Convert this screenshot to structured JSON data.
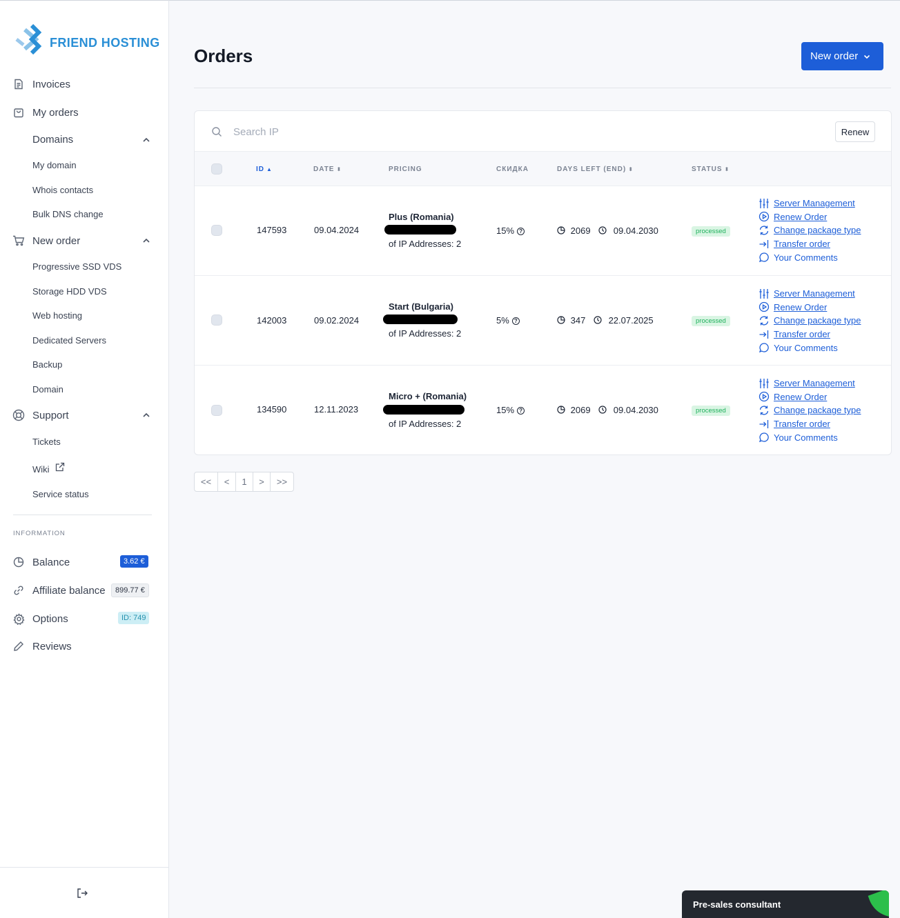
{
  "brand": {
    "name": "FRIEND HOSTING"
  },
  "sidebar": {
    "invoices": "Invoices",
    "my_orders": "My orders",
    "domains": {
      "label": "Domains",
      "items": [
        "My domain",
        "Whois contacts",
        "Bulk DNS change"
      ]
    },
    "new_order": {
      "label": "New order",
      "items": [
        "Progressive SSD VDS",
        "Storage HDD VDS",
        "Web hosting",
        "Dedicated Servers",
        "Backup",
        "Domain"
      ]
    },
    "support": {
      "label": "Support",
      "items": [
        "Tickets",
        "Wiki",
        "Service status"
      ]
    },
    "information_label": "INFORMATION",
    "balance": {
      "label": "Balance",
      "value": "3.62 €"
    },
    "affiliate": {
      "label": "Affiliate balance",
      "value": "899.77 €"
    },
    "options": {
      "label": "Options",
      "value": "ID: 749"
    },
    "reviews": "Reviews"
  },
  "main": {
    "title": "Orders",
    "new_order_button": "New order",
    "search_placeholder": "Search IP",
    "renew_button": "Renew",
    "columns": {
      "id": "ID",
      "date": "DATE",
      "pricing": "PRICING",
      "discount": "СКИДКА",
      "days_left": "DAYS LEFT (END)",
      "status": "STATUS"
    },
    "orders": [
      {
        "id": "147593",
        "date": "09.04.2024",
        "plan": "Plus (Romania)",
        "ips": "of IP Addresses: 2",
        "discount": "15%",
        "days": "2069",
        "end": "09.04.2030",
        "status": "processed"
      },
      {
        "id": "142003",
        "date": "09.02.2024",
        "plan": "Start (Bulgaria)",
        "ips": "of IP Addresses: 2",
        "discount": "5%",
        "days": "347",
        "end": "22.07.2025",
        "status": "processed"
      },
      {
        "id": "134590",
        "date": "12.11.2023",
        "plan": "Micro + (Romania)",
        "ips": "of IP Addresses: 2",
        "discount": "15%",
        "days": "2069",
        "end": "09.04.2030",
        "status": "processed"
      }
    ],
    "actions": [
      "Server Management",
      "Renew Order",
      "Change package type",
      "Transfer order",
      "Your Comments"
    ],
    "pager": [
      "<<",
      "<",
      "1",
      ">",
      ">>"
    ]
  },
  "chat": {
    "label": "Pre-sales consultant"
  },
  "colors": {
    "accent": "#1d5ed8",
    "brand": "#2a8fd6",
    "status_green": "#1fb05c"
  }
}
